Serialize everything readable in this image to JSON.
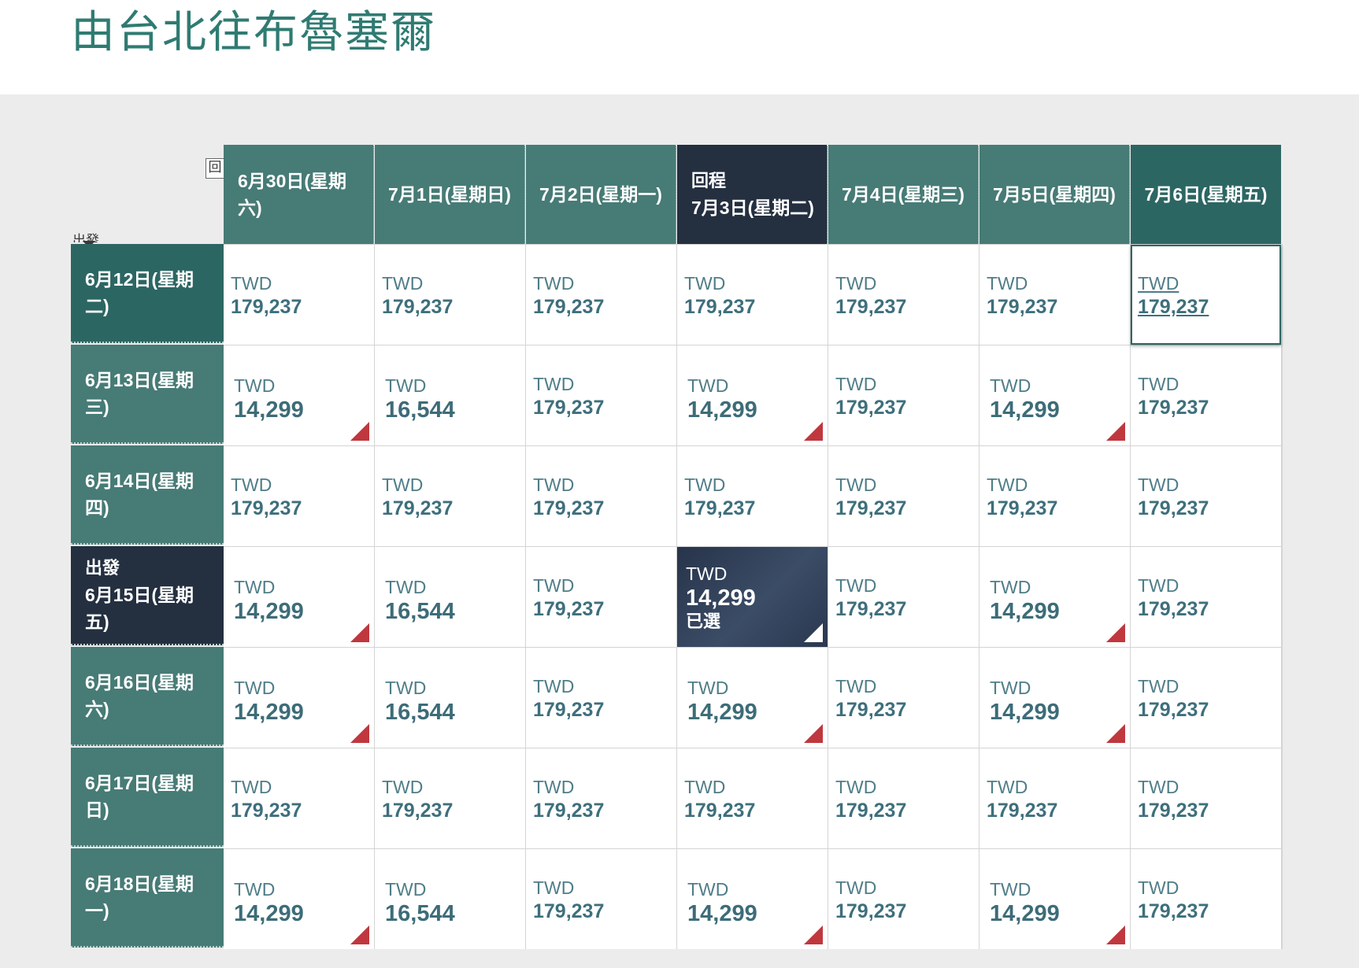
{
  "page": {
    "title": "由台北往布魯塞爾",
    "corner_return_label": "回",
    "corner_depart_label": "出發"
  },
  "return_dates": [
    {
      "label": "6月30日(星期六)",
      "tag": "",
      "state": "normal"
    },
    {
      "label": "7月1日(星期日)",
      "tag": "",
      "state": "normal"
    },
    {
      "label": "7月2日(星期一)",
      "tag": "",
      "state": "normal"
    },
    {
      "label": "7月3日(星期二)",
      "tag": "回程",
      "state": "selected"
    },
    {
      "label": "7月4日(星期三)",
      "tag": "",
      "state": "normal"
    },
    {
      "label": "7月5日(星期四)",
      "tag": "",
      "state": "normal"
    },
    {
      "label": "7月6日(星期五)",
      "tag": "",
      "state": "current"
    }
  ],
  "departure_rows": [
    {
      "label": "6月12日(星期二)",
      "tag": "",
      "state": "current",
      "cells": [
        {
          "currency": "TWD",
          "amount": "179,237",
          "type": "plain"
        },
        {
          "currency": "TWD",
          "amount": "179,237",
          "type": "plain"
        },
        {
          "currency": "TWD",
          "amount": "179,237",
          "type": "plain"
        },
        {
          "currency": "TWD",
          "amount": "179,237",
          "type": "plain"
        },
        {
          "currency": "TWD",
          "amount": "179,237",
          "type": "plain"
        },
        {
          "currency": "TWD",
          "amount": "179,237",
          "type": "plain"
        },
        {
          "currency": "TWD",
          "amount": "179,237",
          "type": "hover"
        }
      ]
    },
    {
      "label": "6月13日(星期三)",
      "tag": "",
      "state": "normal",
      "cells": [
        {
          "currency": "TWD",
          "amount": "14,299",
          "type": "promo"
        },
        {
          "currency": "TWD",
          "amount": "16,544",
          "type": "promo-noflag"
        },
        {
          "currency": "TWD",
          "amount": "179,237",
          "type": "plain"
        },
        {
          "currency": "TWD",
          "amount": "14,299",
          "type": "promo"
        },
        {
          "currency": "TWD",
          "amount": "179,237",
          "type": "plain"
        },
        {
          "currency": "TWD",
          "amount": "14,299",
          "type": "promo"
        },
        {
          "currency": "TWD",
          "amount": "179,237",
          "type": "plain"
        }
      ]
    },
    {
      "label": "6月14日(星期四)",
      "tag": "",
      "state": "normal",
      "cells": [
        {
          "currency": "TWD",
          "amount": "179,237",
          "type": "plain"
        },
        {
          "currency": "TWD",
          "amount": "179,237",
          "type": "plain"
        },
        {
          "currency": "TWD",
          "amount": "179,237",
          "type": "plain"
        },
        {
          "currency": "TWD",
          "amount": "179,237",
          "type": "plain"
        },
        {
          "currency": "TWD",
          "amount": "179,237",
          "type": "plain"
        },
        {
          "currency": "TWD",
          "amount": "179,237",
          "type": "plain"
        },
        {
          "currency": "TWD",
          "amount": "179,237",
          "type": "plain"
        }
      ]
    },
    {
      "label": "6月15日(星期五)",
      "tag": "出發",
      "state": "selected",
      "cells": [
        {
          "currency": "TWD",
          "amount": "14,299",
          "type": "promo"
        },
        {
          "currency": "TWD",
          "amount": "16,544",
          "type": "promo-noflag"
        },
        {
          "currency": "TWD",
          "amount": "179,237",
          "type": "plain"
        },
        {
          "currency": "TWD",
          "amount": "14,299",
          "type": "picked",
          "selected_text": "已選"
        },
        {
          "currency": "TWD",
          "amount": "179,237",
          "type": "plain"
        },
        {
          "currency": "TWD",
          "amount": "14,299",
          "type": "promo"
        },
        {
          "currency": "TWD",
          "amount": "179,237",
          "type": "plain"
        }
      ]
    },
    {
      "label": "6月16日(星期六)",
      "tag": "",
      "state": "normal",
      "cells": [
        {
          "currency": "TWD",
          "amount": "14,299",
          "type": "promo"
        },
        {
          "currency": "TWD",
          "amount": "16,544",
          "type": "promo-noflag"
        },
        {
          "currency": "TWD",
          "amount": "179,237",
          "type": "plain"
        },
        {
          "currency": "TWD",
          "amount": "14,299",
          "type": "promo"
        },
        {
          "currency": "TWD",
          "amount": "179,237",
          "type": "plain"
        },
        {
          "currency": "TWD",
          "amount": "14,299",
          "type": "promo"
        },
        {
          "currency": "TWD",
          "amount": "179,237",
          "type": "plain"
        }
      ]
    },
    {
      "label": "6月17日(星期日)",
      "tag": "",
      "state": "normal",
      "cells": [
        {
          "currency": "TWD",
          "amount": "179,237",
          "type": "plain"
        },
        {
          "currency": "TWD",
          "amount": "179,237",
          "type": "plain"
        },
        {
          "currency": "TWD",
          "amount": "179,237",
          "type": "plain"
        },
        {
          "currency": "TWD",
          "amount": "179,237",
          "type": "plain"
        },
        {
          "currency": "TWD",
          "amount": "179,237",
          "type": "plain"
        },
        {
          "currency": "TWD",
          "amount": "179,237",
          "type": "plain"
        },
        {
          "currency": "TWD",
          "amount": "179,237",
          "type": "plain"
        }
      ]
    },
    {
      "label": "6月18日(星期一)",
      "tag": "",
      "state": "normal",
      "cells": [
        {
          "currency": "TWD",
          "amount": "14,299",
          "type": "promo"
        },
        {
          "currency": "TWD",
          "amount": "16,544",
          "type": "promo-noflag"
        },
        {
          "currency": "TWD",
          "amount": "179,237",
          "type": "plain"
        },
        {
          "currency": "TWD",
          "amount": "14,299",
          "type": "promo"
        },
        {
          "currency": "TWD",
          "amount": "179,237",
          "type": "plain"
        },
        {
          "currency": "TWD",
          "amount": "14,299",
          "type": "promo"
        },
        {
          "currency": "TWD",
          "amount": "179,237",
          "type": "plain"
        }
      ]
    }
  ],
  "colors": {
    "title": "#2f7b72",
    "header_bg": "#477b76",
    "header_current_bg": "#2c6663",
    "header_selected_bg": "#242f40",
    "promo_flag": "#c0373e",
    "price_text": "#3e6f7c",
    "panel_bg": "#ececec"
  }
}
